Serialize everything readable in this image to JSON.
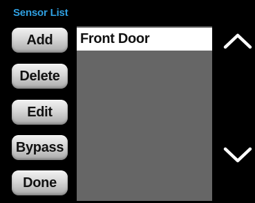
{
  "header": {
    "title": "Sensor List"
  },
  "buttons": {
    "add": "Add",
    "delete": "Delete",
    "edit": "Edit",
    "bypass": "Bypass",
    "done": "Done"
  },
  "sensor_list": {
    "items": [
      "Front Door"
    ]
  },
  "scroll": {
    "up_icon": "chevron-up-icon",
    "down_icon": "chevron-down-icon"
  },
  "colors": {
    "background": "#000000",
    "title": "#2f9fe0",
    "list_panel": "#666666",
    "selected_item": "#ffffff"
  }
}
